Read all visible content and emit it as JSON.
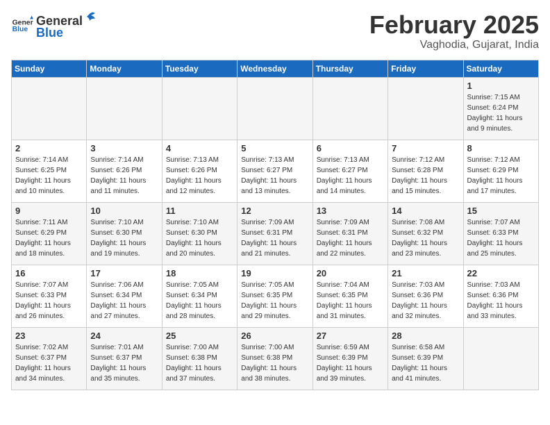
{
  "logo": {
    "text_general": "General",
    "text_blue": "Blue"
  },
  "header": {
    "title": "February 2025",
    "subtitle": "Vaghodia, Gujarat, India"
  },
  "days_of_week": [
    "Sunday",
    "Monday",
    "Tuesday",
    "Wednesday",
    "Thursday",
    "Friday",
    "Saturday"
  ],
  "weeks": [
    [
      {
        "day": "",
        "detail": ""
      },
      {
        "day": "",
        "detail": ""
      },
      {
        "day": "",
        "detail": ""
      },
      {
        "day": "",
        "detail": ""
      },
      {
        "day": "",
        "detail": ""
      },
      {
        "day": "",
        "detail": ""
      },
      {
        "day": "1",
        "detail": "Sunrise: 7:15 AM\nSunset: 6:24 PM\nDaylight: 11 hours\nand 9 minutes."
      }
    ],
    [
      {
        "day": "2",
        "detail": "Sunrise: 7:14 AM\nSunset: 6:25 PM\nDaylight: 11 hours\nand 10 minutes."
      },
      {
        "day": "3",
        "detail": "Sunrise: 7:14 AM\nSunset: 6:26 PM\nDaylight: 11 hours\nand 11 minutes."
      },
      {
        "day": "4",
        "detail": "Sunrise: 7:13 AM\nSunset: 6:26 PM\nDaylight: 11 hours\nand 12 minutes."
      },
      {
        "day": "5",
        "detail": "Sunrise: 7:13 AM\nSunset: 6:27 PM\nDaylight: 11 hours\nand 13 minutes."
      },
      {
        "day": "6",
        "detail": "Sunrise: 7:13 AM\nSunset: 6:27 PM\nDaylight: 11 hours\nand 14 minutes."
      },
      {
        "day": "7",
        "detail": "Sunrise: 7:12 AM\nSunset: 6:28 PM\nDaylight: 11 hours\nand 15 minutes."
      },
      {
        "day": "8",
        "detail": "Sunrise: 7:12 AM\nSunset: 6:29 PM\nDaylight: 11 hours\nand 17 minutes."
      }
    ],
    [
      {
        "day": "9",
        "detail": "Sunrise: 7:11 AM\nSunset: 6:29 PM\nDaylight: 11 hours\nand 18 minutes."
      },
      {
        "day": "10",
        "detail": "Sunrise: 7:10 AM\nSunset: 6:30 PM\nDaylight: 11 hours\nand 19 minutes."
      },
      {
        "day": "11",
        "detail": "Sunrise: 7:10 AM\nSunset: 6:30 PM\nDaylight: 11 hours\nand 20 minutes."
      },
      {
        "day": "12",
        "detail": "Sunrise: 7:09 AM\nSunset: 6:31 PM\nDaylight: 11 hours\nand 21 minutes."
      },
      {
        "day": "13",
        "detail": "Sunrise: 7:09 AM\nSunset: 6:31 PM\nDaylight: 11 hours\nand 22 minutes."
      },
      {
        "day": "14",
        "detail": "Sunrise: 7:08 AM\nSunset: 6:32 PM\nDaylight: 11 hours\nand 23 minutes."
      },
      {
        "day": "15",
        "detail": "Sunrise: 7:07 AM\nSunset: 6:33 PM\nDaylight: 11 hours\nand 25 minutes."
      }
    ],
    [
      {
        "day": "16",
        "detail": "Sunrise: 7:07 AM\nSunset: 6:33 PM\nDaylight: 11 hours\nand 26 minutes."
      },
      {
        "day": "17",
        "detail": "Sunrise: 7:06 AM\nSunset: 6:34 PM\nDaylight: 11 hours\nand 27 minutes."
      },
      {
        "day": "18",
        "detail": "Sunrise: 7:05 AM\nSunset: 6:34 PM\nDaylight: 11 hours\nand 28 minutes."
      },
      {
        "day": "19",
        "detail": "Sunrise: 7:05 AM\nSunset: 6:35 PM\nDaylight: 11 hours\nand 29 minutes."
      },
      {
        "day": "20",
        "detail": "Sunrise: 7:04 AM\nSunset: 6:35 PM\nDaylight: 11 hours\nand 31 minutes."
      },
      {
        "day": "21",
        "detail": "Sunrise: 7:03 AM\nSunset: 6:36 PM\nDaylight: 11 hours\nand 32 minutes."
      },
      {
        "day": "22",
        "detail": "Sunrise: 7:03 AM\nSunset: 6:36 PM\nDaylight: 11 hours\nand 33 minutes."
      }
    ],
    [
      {
        "day": "23",
        "detail": "Sunrise: 7:02 AM\nSunset: 6:37 PM\nDaylight: 11 hours\nand 34 minutes."
      },
      {
        "day": "24",
        "detail": "Sunrise: 7:01 AM\nSunset: 6:37 PM\nDaylight: 11 hours\nand 35 minutes."
      },
      {
        "day": "25",
        "detail": "Sunrise: 7:00 AM\nSunset: 6:38 PM\nDaylight: 11 hours\nand 37 minutes."
      },
      {
        "day": "26",
        "detail": "Sunrise: 7:00 AM\nSunset: 6:38 PM\nDaylight: 11 hours\nand 38 minutes."
      },
      {
        "day": "27",
        "detail": "Sunrise: 6:59 AM\nSunset: 6:39 PM\nDaylight: 11 hours\nand 39 minutes."
      },
      {
        "day": "28",
        "detail": "Sunrise: 6:58 AM\nSunset: 6:39 PM\nDaylight: 11 hours\nand 41 minutes."
      },
      {
        "day": "",
        "detail": ""
      }
    ]
  ]
}
